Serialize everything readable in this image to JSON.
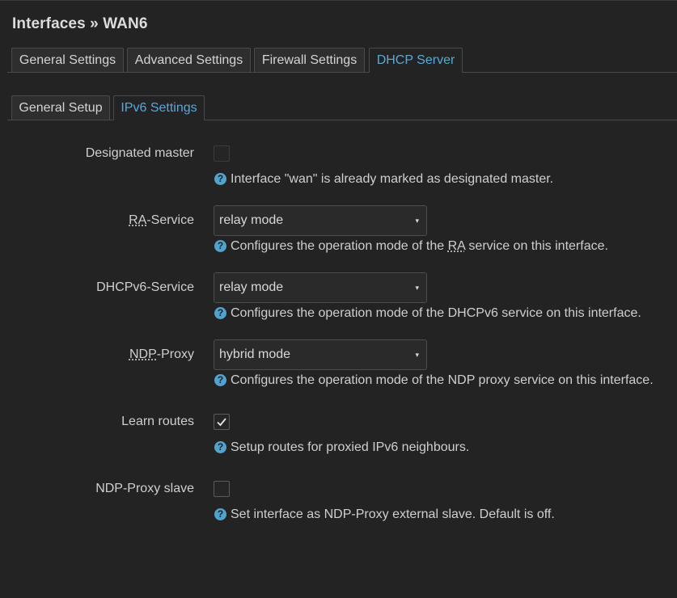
{
  "page_title": "Interfaces » WAN6",
  "main_tabs": [
    {
      "label": "General Settings",
      "active": false
    },
    {
      "label": "Advanced Settings",
      "active": false
    },
    {
      "label": "Firewall Settings",
      "active": false
    },
    {
      "label": "DHCP Server",
      "active": true
    }
  ],
  "sub_tabs": [
    {
      "label": "General Setup",
      "active": false
    },
    {
      "label": "IPv6 Settings",
      "active": true
    }
  ],
  "fields": {
    "designated_master": {
      "label": "Designated master",
      "checked": false,
      "disabled": true,
      "help": "Interface \"wan\" is already marked as designated master."
    },
    "ra_service": {
      "label_abbr": "RA",
      "label_rest": "-Service",
      "value": "relay mode",
      "help_pre": "Configures the operation mode of the ",
      "help_abbr": "RA",
      "help_post": " service on this interface."
    },
    "dhcpv6_service": {
      "label": "DHCPv6-Service",
      "value": "relay mode",
      "help": "Configures the operation mode of the DHCPv6 service on this interface."
    },
    "ndp_proxy": {
      "label_abbr": "NDP",
      "label_rest": "-Proxy",
      "value": "hybrid mode",
      "help": "Configures the operation mode of the NDP proxy service on this interface."
    },
    "learn_routes": {
      "label": "Learn routes",
      "checked": true,
      "help": "Setup routes for proxied IPv6 neighbours."
    },
    "ndp_proxy_slave": {
      "label": "NDP-Proxy slave",
      "checked": false,
      "help": "Set interface as NDP-Proxy external slave. Default is off."
    }
  },
  "help_icon_glyph": "?",
  "dropdown_caret": "▾",
  "colors": {
    "background": "#232323",
    "accent": "#5aa8d6",
    "help_icon": "#4fa3cf"
  }
}
